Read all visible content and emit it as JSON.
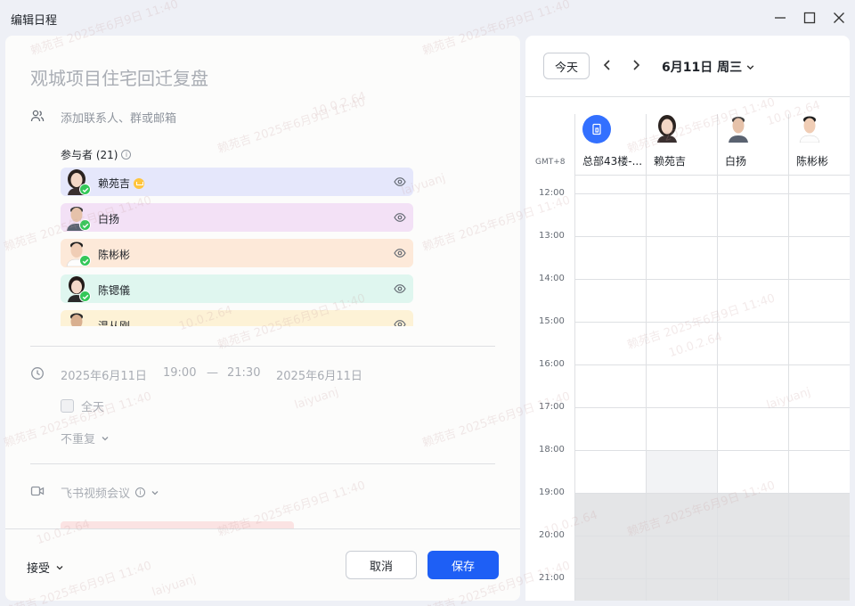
{
  "window": {
    "title": "编辑日程"
  },
  "event": {
    "title": "观城项目住宅回迁复盘",
    "add_contact_placeholder": "添加联系人、群或邮箱",
    "attendees_label": "参与者 (21)",
    "attendees": [
      {
        "name": "赖苑吉",
        "color": "#e5e7fb",
        "organizer": true
      },
      {
        "name": "白扬",
        "color": "#f3e1f6",
        "organizer": false
      },
      {
        "name": "陈彬彬",
        "color": "#fde9d9",
        "organizer": false
      },
      {
        "name": "陈锶儀",
        "color": "#dff6ef",
        "organizer": false
      },
      {
        "name": "温从刚",
        "color": "#fdf2d6",
        "organizer": false
      }
    ],
    "start_date": "2025年6月11日",
    "start_time": "19:00",
    "dash": "—",
    "end_time": "21:30",
    "end_date": "2025年6月11日",
    "all_day_label": "全天",
    "repeat_label": "不重复",
    "video_label": "飞书视频会议"
  },
  "footer": {
    "rsvp_label": "接受",
    "cancel_label": "取消",
    "save_label": "保存"
  },
  "calendar": {
    "today_label": "今天",
    "date_label": "6月11日 周三",
    "timezone": "GMT+8",
    "columns": [
      "总部43楼-...",
      "赖苑吉",
      "白扬",
      "陈彬彬"
    ],
    "hours": [
      "12:00",
      "13:00",
      "14:00",
      "15:00",
      "16:00",
      "17:00",
      "18:00",
      "19:00",
      "20:00",
      "21:00"
    ]
  },
  "watermark": {
    "text": "赖苑吉 2025年6月9日 11:40",
    "ip": "10.0.2.64",
    "user": "laiyuanj"
  },
  "colors": {
    "accent": "#1e5ff5",
    "success": "#34c759",
    "room": "#3370ff"
  }
}
